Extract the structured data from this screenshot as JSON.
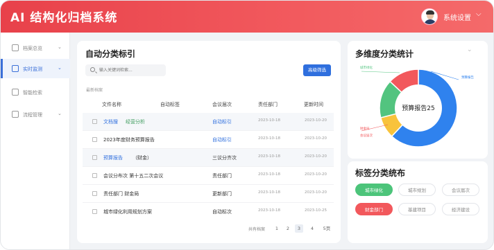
{
  "app": {
    "title": "AI 结构化归档系统",
    "settings_label": "系统设置"
  },
  "sidebar": {
    "items": [
      {
        "label": "档案总览",
        "icon": "archive-icon"
      },
      {
        "label": "实时监测",
        "icon": "monitor-icon"
      },
      {
        "label": "智能检索",
        "icon": "search-icon"
      },
      {
        "label": "流程管理",
        "icon": "flow-icon"
      }
    ]
  },
  "classify": {
    "title": "自动分类标引",
    "search_placeholder": "输入关键词检索...",
    "filter_label": "高级筛选",
    "recent_label": "最新档案",
    "columns": [
      "文件名称",
      "自动标签",
      "会议届次",
      "责任部门",
      "更新时间"
    ],
    "rows": [
      {
        "name": "文档搜",
        "tag": "经营分析",
        "session": "自动标引",
        "dept": "2023-10-18",
        "time": "2023-10-20"
      },
      {
        "name": "2023年度财务预算报告",
        "tag": "",
        "session": "自动标引",
        "dept": "2023-10-18",
        "time": "2023-10-20"
      },
      {
        "name": "预算报告",
        "tag": "（财金）",
        "session": "三议分齐次",
        "dept": "2023-10-18",
        "time": "2023-10-20"
      },
      {
        "name": "会议分布次 第十五二次会议",
        "tag": "",
        "session": "责任部门",
        "dept": "2023-10-18",
        "time": "2023-10-20"
      },
      {
        "name": "责任部门 财金局",
        "tag": "",
        "session": "更新部门",
        "dept": "2023-10-18",
        "time": "2023-10-20"
      },
      {
        "name": "城市绿化利用规划方案",
        "tag": "",
        "session": "自动标次",
        "dept": "2023-10-18",
        "time": "2023-10-25"
      }
    ],
    "pager": {
      "total": "共有档案",
      "pages": [
        "1",
        "2",
        "3",
        "4"
      ],
      "last": "5页"
    }
  },
  "stats": {
    "title": "多维度分类统计",
    "center_label": "预算报告25",
    "labels": [
      "预算报告",
      "城市绿化",
      "财金局",
      "会议届次"
    ]
  },
  "tags": {
    "title": "标签分类统布",
    "items": [
      "城市绿化",
      "城市规划",
      "会议届次",
      "财金部门",
      "基建项目",
      "经济建设"
    ]
  },
  "colors": {
    "accent": "#e8414a",
    "blue": "#2f6fde",
    "green": "#4cc47a",
    "orange": "#f5a34a",
    "red": "#f2585c"
  },
  "chart_data": {
    "type": "pie",
    "categories": [
      "蓝",
      "黄",
      "绿",
      "红"
    ],
    "values": [
      62,
      9,
      16,
      13
    ],
    "colors": [
      "#2f82ee",
      "#f8c33c",
      "#52c47f",
      "#f2585c"
    ]
  }
}
